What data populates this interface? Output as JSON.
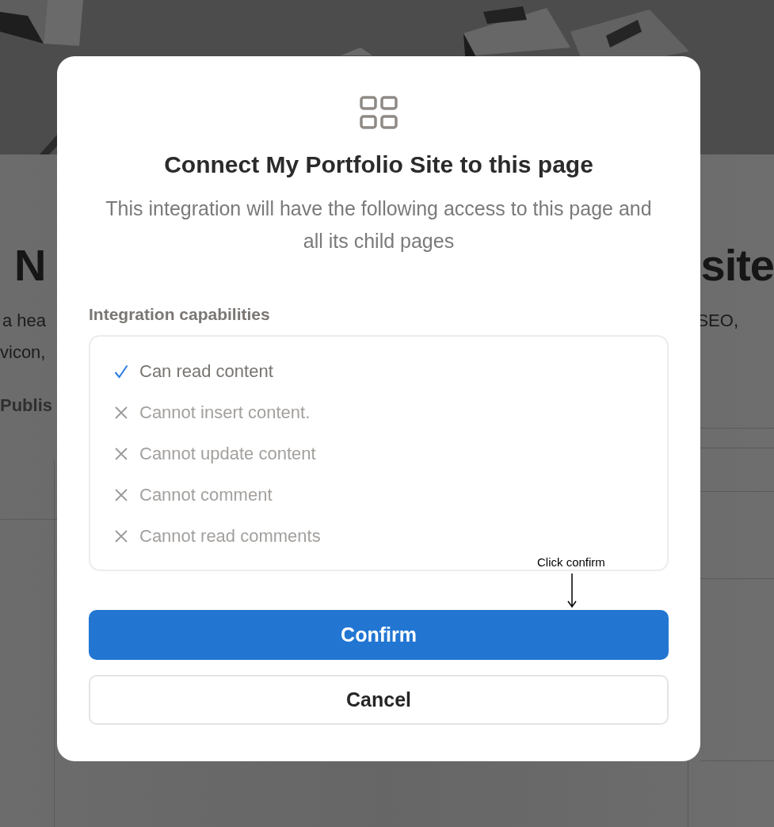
{
  "background_page": {
    "heading_left": "N",
    "heading_right": "site",
    "description_left": [
      "a hea",
      "vicon,"
    ],
    "description_right": "SEO,",
    "section_label": "Publis"
  },
  "dialog": {
    "title": "Connect My Portfolio Site to this page",
    "subtitle": "This integration will have the following access to this page and all its child pages",
    "capabilities_label": "Integration capabilities",
    "capabilities": [
      {
        "label": "Can read content",
        "allowed": true
      },
      {
        "label": "Cannot insert content.",
        "allowed": false
      },
      {
        "label": "Cannot update content",
        "allowed": false
      },
      {
        "label": "Cannot comment",
        "allowed": false
      },
      {
        "label": "Cannot read comments",
        "allowed": false
      }
    ],
    "annotation": "Click confirm",
    "buttons": [
      {
        "label": "Confirm",
        "kind": "primary"
      },
      {
        "label": "Cancel",
        "kind": "secondary"
      }
    ]
  }
}
